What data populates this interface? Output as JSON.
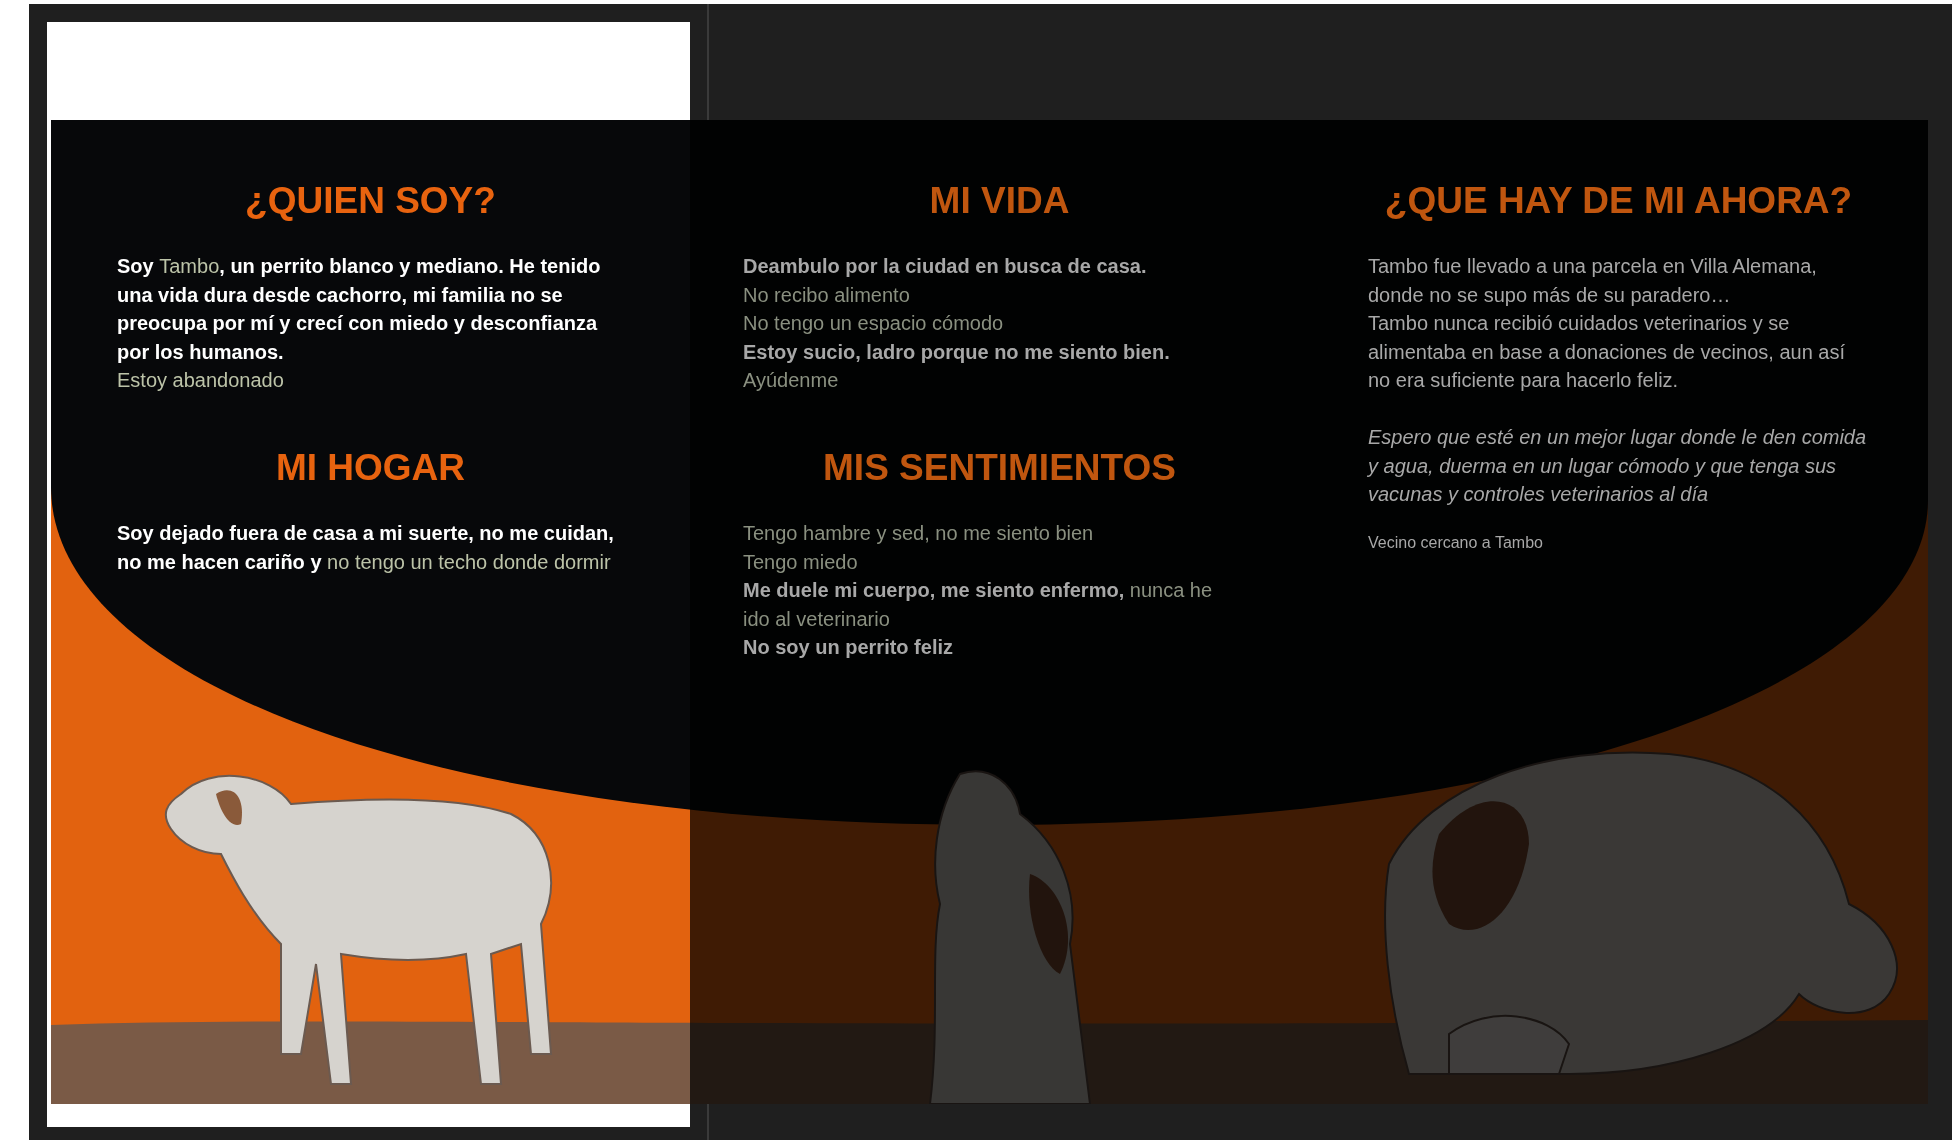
{
  "columns": [
    {
      "dimmed": false,
      "kind": "standing",
      "sections": [
        {
          "heading": "¿QUIEN SOY?",
          "blocks": [
            {
              "kind": "body",
              "segments": [
                {
                  "text": "Soy ",
                  "highlight": false
                },
                {
                  "text": "Tambo",
                  "highlight": true
                },
                {
                  "text": ", un perrito blanco y mediano. He tenido una vida dura desde cachorro, mi familia no se preocupa por mí y crecí con miedo y desconfianza por los humanos.",
                  "highlight": false
                }
              ]
            },
            {
              "kind": "body",
              "segments": [
                {
                  "text": "Estoy abandonado",
                  "highlight": true
                }
              ]
            }
          ]
        },
        {
          "heading": "MI HOGAR",
          "blocks": [
            {
              "kind": "body",
              "segments": [
                {
                  "text": "Soy dejado fuera de casa a mi suerte, no me cuidan, no me hacen cariño y ",
                  "highlight": false
                },
                {
                  "text": "no tengo un techo donde dormir",
                  "highlight": true
                }
              ]
            }
          ]
        }
      ]
    },
    {
      "dimmed": true,
      "kind": "howling",
      "sections": [
        {
          "heading": "MI VIDA",
          "blocks": [
            {
              "kind": "body",
              "segments": [
                {
                  "text": "Deambulo por la ciudad en busca de casa.",
                  "highlight": false
                }
              ]
            },
            {
              "kind": "body",
              "segments": [
                {
                  "text": "No recibo alimento",
                  "highlight": true
                }
              ]
            },
            {
              "kind": "body",
              "segments": [
                {
                  "text": "No tengo un espacio cómodo",
                  "highlight": true
                }
              ]
            },
            {
              "kind": "body",
              "segments": [
                {
                  "text": "Estoy sucio, ladro porque no me siento bien.",
                  "highlight": false
                }
              ]
            },
            {
              "kind": "body",
              "segments": [
                {
                  "text": "Ayúdenme",
                  "highlight": true
                }
              ]
            }
          ]
        },
        {
          "heading": "MIS SENTIMIENTOS",
          "blocks": [
            {
              "kind": "body",
              "segments": [
                {
                  "text": "Tengo hambre y sed, no me siento bien",
                  "highlight": true
                }
              ]
            },
            {
              "kind": "body",
              "segments": [
                {
                  "text": "Tengo miedo",
                  "highlight": true
                }
              ]
            },
            {
              "kind": "body",
              "segments": [
                {
                  "text": "Me duele mi cuerpo, me siento enfermo, ",
                  "highlight": false
                },
                {
                  "text": "nunca he ido al veterinario",
                  "highlight": true
                }
              ]
            },
            {
              "kind": "body",
              "segments": [
                {
                  "text": "No soy un perrito feliz",
                  "highlight": false
                }
              ]
            }
          ]
        }
      ]
    },
    {
      "dimmed": true,
      "kind": "lying",
      "sections": [
        {
          "heading": "¿QUE HAY DE MI AHORA?",
          "blocks": [
            {
              "kind": "body",
              "segments": [
                {
                  "text": "Tambo fue llevado a una parcela en Villa Alemana, donde no se supo más de su paradero…",
                  "highlight": false
                }
              ]
            },
            {
              "kind": "body",
              "segments": [
                {
                  "text": "Tambo nunca recibió cuidados veterinarios y se alimentaba en base a donaciones de vecinos, aun así no era suficiente para hacerlo feliz.",
                  "highlight": false
                }
              ]
            },
            {
              "kind": "italic",
              "segments": [
                {
                  "text": "Espero que esté en un mejor lugar donde le den comida y agua, duerma en un lugar cómodo y que tenga sus vacunas y controles veterinarios al día",
                  "highlight": false
                }
              ]
            },
            {
              "kind": "caption",
              "segments": [
                {
                  "text": "Vecino cercano a Tambo",
                  "highlight": false
                }
              ]
            }
          ]
        }
      ]
    }
  ]
}
